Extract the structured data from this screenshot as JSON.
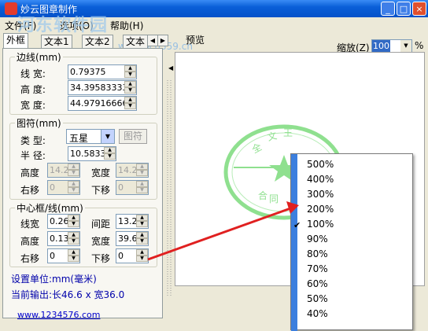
{
  "window": {
    "title": "妙云图章制作"
  },
  "watermark": {
    "line1": "河东软件园",
    "line2": "www.pc0359.cn"
  },
  "menu": {
    "items": [
      "文件(F)",
      "选项(O)",
      "帮助(H)"
    ]
  },
  "tabs": [
    "外框",
    "文本1",
    "文本2",
    "文本"
  ],
  "border_group": {
    "title": "边线(mm)",
    "line_width_label": "线  宽:",
    "line_width": "0.79375",
    "height_label": "高  度:",
    "height": "34.39583333",
    "width_label": "宽  度:",
    "width": "44.97916666"
  },
  "symbol_group": {
    "title": "图符(mm)",
    "type_label": "类  型:",
    "type": "五星",
    "symbol_button": "图符",
    "radius_label": "半  径:",
    "radius": "10.5833",
    "height_label": "高度",
    "height": "14.2",
    "width_label": "宽度",
    "width": "14.2",
    "right_label": "右移",
    "right": "0",
    "down_label": "下移",
    "down": "0"
  },
  "center_group": {
    "title": "中心框/线(mm)",
    "line_width_label": "线宽",
    "line_width": "0.26",
    "spacing_label": "间距",
    "spacing": "13.2",
    "height_label": "高度",
    "height": "0.13",
    "width_label": "宽度",
    "width": "39.6",
    "right_label": "右移",
    "right": "0",
    "down_label": "下移",
    "down": "0"
  },
  "info": {
    "unit": "设置单位:mm(毫米)",
    "output": "当前输出:长46.6 x 宽36.0",
    "url": "www.1234576.com"
  },
  "preview": {
    "label": "预览",
    "zoom_label": "缩放(Z)",
    "zoom_value": "100",
    "zoom_unit": "%",
    "stamp_text": "文王",
    "stamp_color": "#8fe08f"
  },
  "zoom_menu": {
    "items": [
      "500%",
      "400%",
      "300%",
      "200%",
      "100%",
      "90%",
      "80%",
      "70%",
      "60%",
      "50%",
      "40%"
    ],
    "checked": "100%"
  },
  "colors": {
    "accent": "#0a5fd8",
    "arrow": "#e02020",
    "popup_bar": "#3c7fde"
  }
}
